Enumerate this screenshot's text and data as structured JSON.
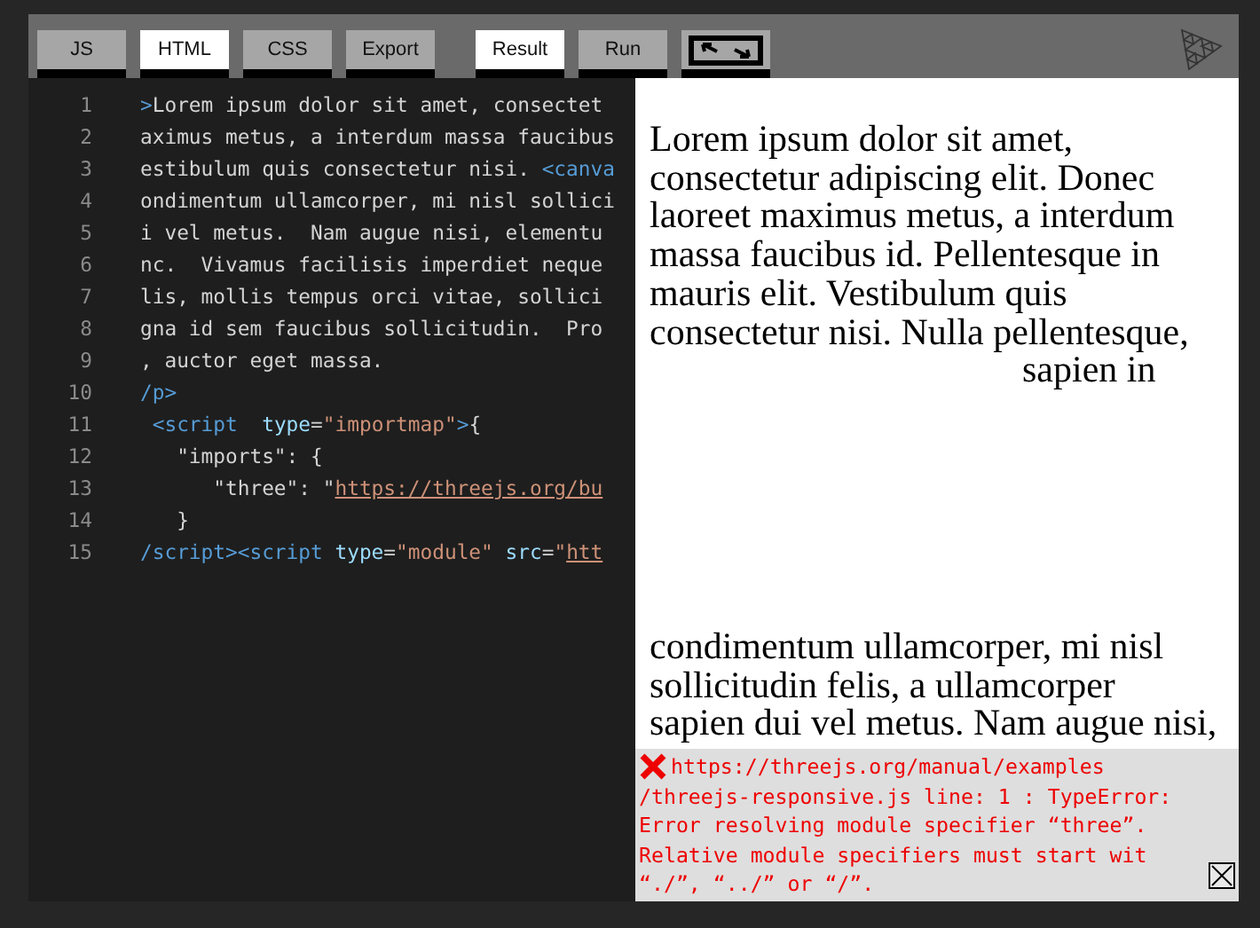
{
  "toolbar": {
    "left_buttons": [
      {
        "label": "JS",
        "selected": false
      },
      {
        "label": "HTML",
        "selected": true
      },
      {
        "label": "CSS",
        "selected": false
      },
      {
        "label": "Export",
        "selected": false
      }
    ],
    "right_buttons": [
      {
        "label": "Result",
        "selected": true
      },
      {
        "label": "Run",
        "selected": false
      }
    ]
  },
  "editor": {
    "lines": [
      {
        "number": "1",
        "tokens": [
          {
            "kind": "tag",
            "text": ">"
          },
          {
            "kind": "text",
            "text": "Lorem ipsum dolor sit amet, consectet"
          }
        ]
      },
      {
        "number": "2",
        "tokens": [
          {
            "kind": "text",
            "text": "aximus metus, a interdum massa faucibus"
          }
        ]
      },
      {
        "number": "3",
        "tokens": [
          {
            "kind": "text",
            "text": "estibulum quis consectetur nisi. "
          },
          {
            "kind": "tag",
            "text": "<canva"
          }
        ]
      },
      {
        "number": "4",
        "tokens": [
          {
            "kind": "text",
            "text": "ondimentum ullamcorper, mi nisl sollici"
          }
        ]
      },
      {
        "number": "5",
        "tokens": [
          {
            "kind": "text",
            "text": "i vel metus.  Nam augue nisi, elementu"
          }
        ]
      },
      {
        "number": "6",
        "tokens": [
          {
            "kind": "text",
            "text": "nc.  Vivamus facilisis imperdiet neque"
          }
        ]
      },
      {
        "number": "7",
        "tokens": [
          {
            "kind": "text",
            "text": "lis, mollis tempus orci vitae, sollici"
          }
        ]
      },
      {
        "number": "8",
        "tokens": [
          {
            "kind": "text",
            "text": "gna id sem faucibus sollicitudin.  Pro"
          }
        ]
      },
      {
        "number": "9",
        "tokens": [
          {
            "kind": "text",
            "text": ", auctor eget massa."
          }
        ]
      },
      {
        "number": "10",
        "tokens": [
          {
            "kind": "tag",
            "text": "/p>"
          }
        ]
      },
      {
        "number": "11",
        "tokens": [
          {
            "kind": "tag",
            "text": " <script"
          },
          {
            "kind": "attr",
            "text": "  type"
          },
          {
            "kind": "text",
            "text": "="
          },
          {
            "kind": "string",
            "text": "\"importmap\""
          },
          {
            "kind": "tag",
            "text": ">"
          },
          {
            "kind": "text",
            "text": "{"
          }
        ]
      },
      {
        "number": "12",
        "tokens": [
          {
            "kind": "text",
            "text": "   \"imports\": {"
          }
        ]
      },
      {
        "number": "13",
        "tokens": [
          {
            "kind": "text",
            "text": "      \"three\": \""
          },
          {
            "kind": "link",
            "text": "https://threejs.org/bu"
          }
        ]
      },
      {
        "number": "14",
        "tokens": [
          {
            "kind": "text",
            "text": "   }"
          }
        ]
      },
      {
        "number": "15",
        "tokens": [
          {
            "kind": "tag",
            "text": "/script><script"
          },
          {
            "kind": "attr",
            "text": " type"
          },
          {
            "kind": "text",
            "text": "="
          },
          {
            "kind": "string",
            "text": "\"module\""
          },
          {
            "kind": "attr",
            "text": " src"
          },
          {
            "kind": "text",
            "text": "="
          },
          {
            "kind": "string",
            "text": "\""
          },
          {
            "kind": "link",
            "text": "htt"
          }
        ]
      }
    ]
  },
  "result": {
    "lines": [
      {
        "kind": "plain",
        "text": "Lorem ipsum dolor sit amet,"
      },
      {
        "kind": "plain",
        "text": "consectetur adipiscing elit. Donec"
      },
      {
        "kind": "plain",
        "text": "laoreet maximus metus, a interdum"
      },
      {
        "kind": "plain",
        "text": "massa faucibus id. Pellentesque in"
      },
      {
        "kind": "plain",
        "text": "mauris elit. Vestibulum quis"
      },
      {
        "kind": "plain",
        "text": "consectetur nisi. Nulla pellentesque,"
      },
      {
        "kind": "break",
        "text": "sapien in"
      },
      {
        "kind": "plain",
        "text": "condimentum ullamcorper, mi nisl"
      },
      {
        "kind": "plain",
        "text": "sollicitudin felis, a ullamcorper"
      },
      {
        "kind": "plain",
        "text": "sapien dui vel metus. Nam augue nisi,"
      }
    ]
  },
  "error": {
    "lines": [
      "https://threejs.org/manual/examples",
      "/threejs-responsive.js line: 1 : TypeError: Error resolving module specifier “three”. Relative module specifiers must start wit “./”, “../” or “/”."
    ]
  }
}
